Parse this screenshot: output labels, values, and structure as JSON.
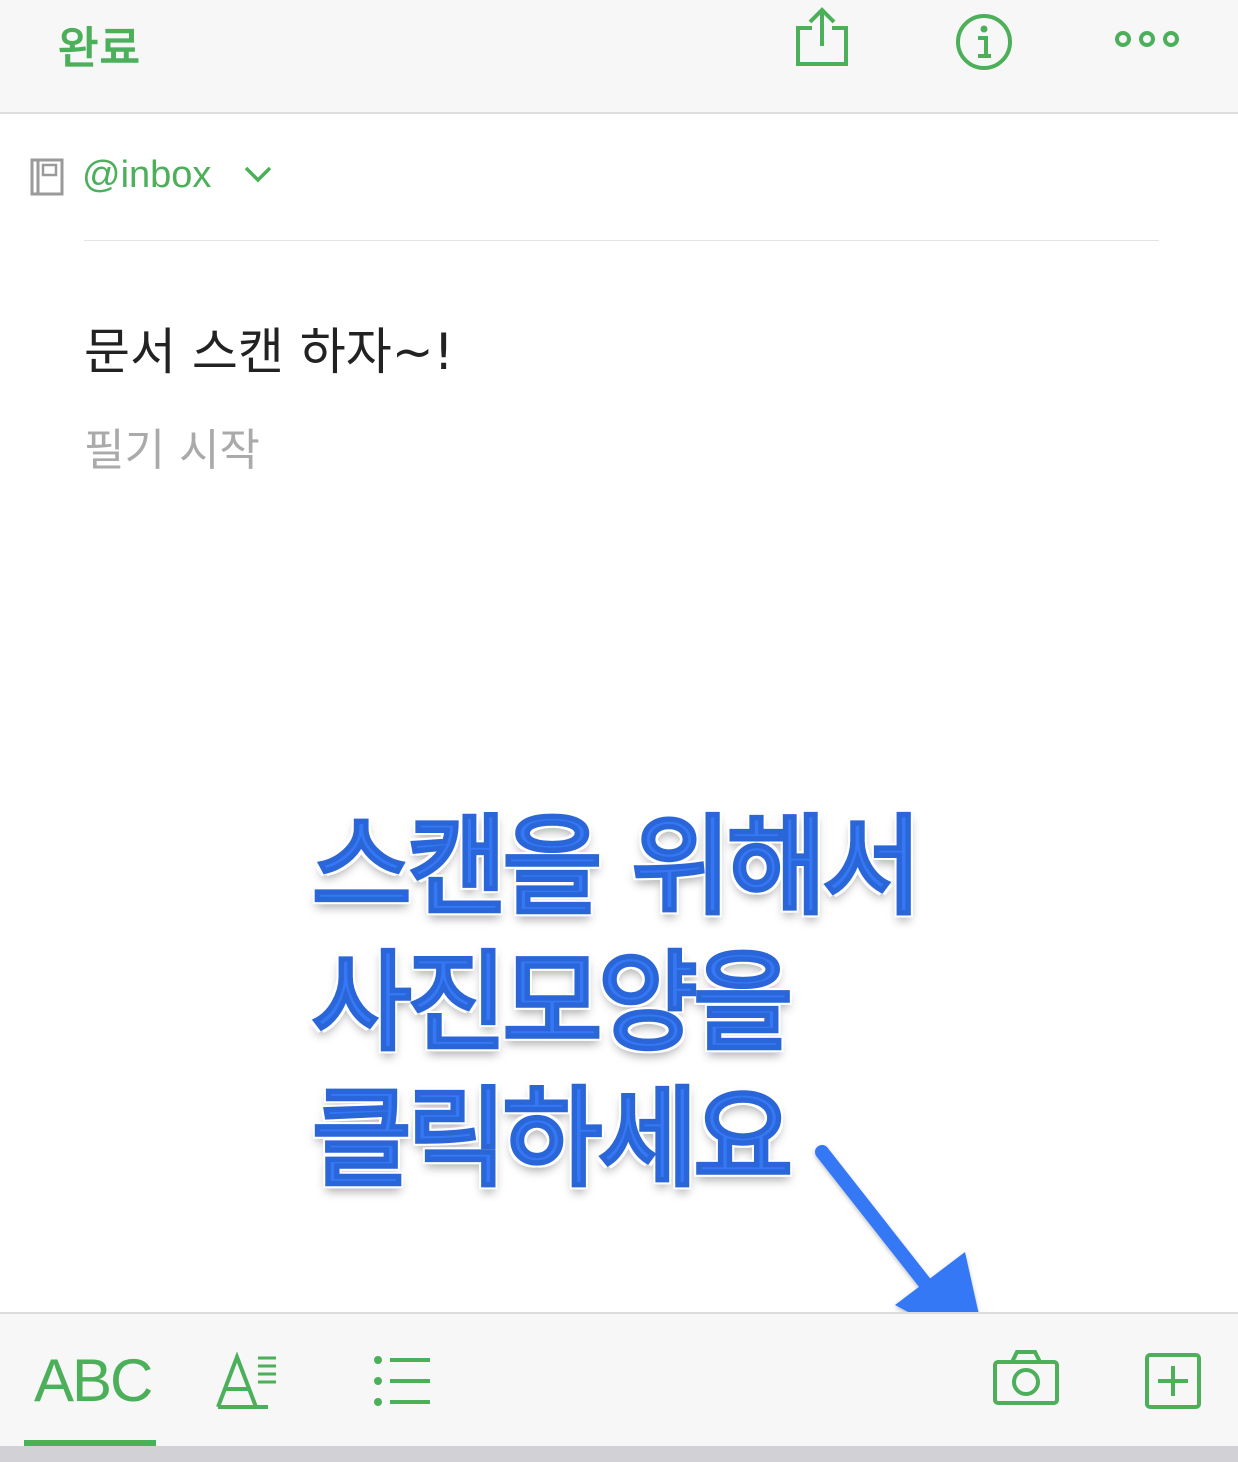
{
  "topbar": {
    "done_label": "완료",
    "icons": [
      "share-icon",
      "info-icon",
      "more-icon"
    ]
  },
  "notebook": {
    "name": "@inbox",
    "icon": "notebook-icon",
    "chevron": "chevron-down-icon"
  },
  "note": {
    "title": "문서 스캔 하자~!",
    "body_placeholder": "필기 시작"
  },
  "annotation": {
    "lines": [
      "스캔을 위해서",
      "사진모양을",
      "클릭하세요"
    ]
  },
  "toolbar": {
    "text_format_label": "ABC",
    "items": [
      "text-style-icon",
      "list-icon",
      "camera-icon",
      "add-attachment-icon"
    ]
  },
  "colors": {
    "accent": "#4caf5a",
    "annotation": "#3478f6",
    "background": "#ffffff",
    "bar_background": "#f7f7f7"
  }
}
